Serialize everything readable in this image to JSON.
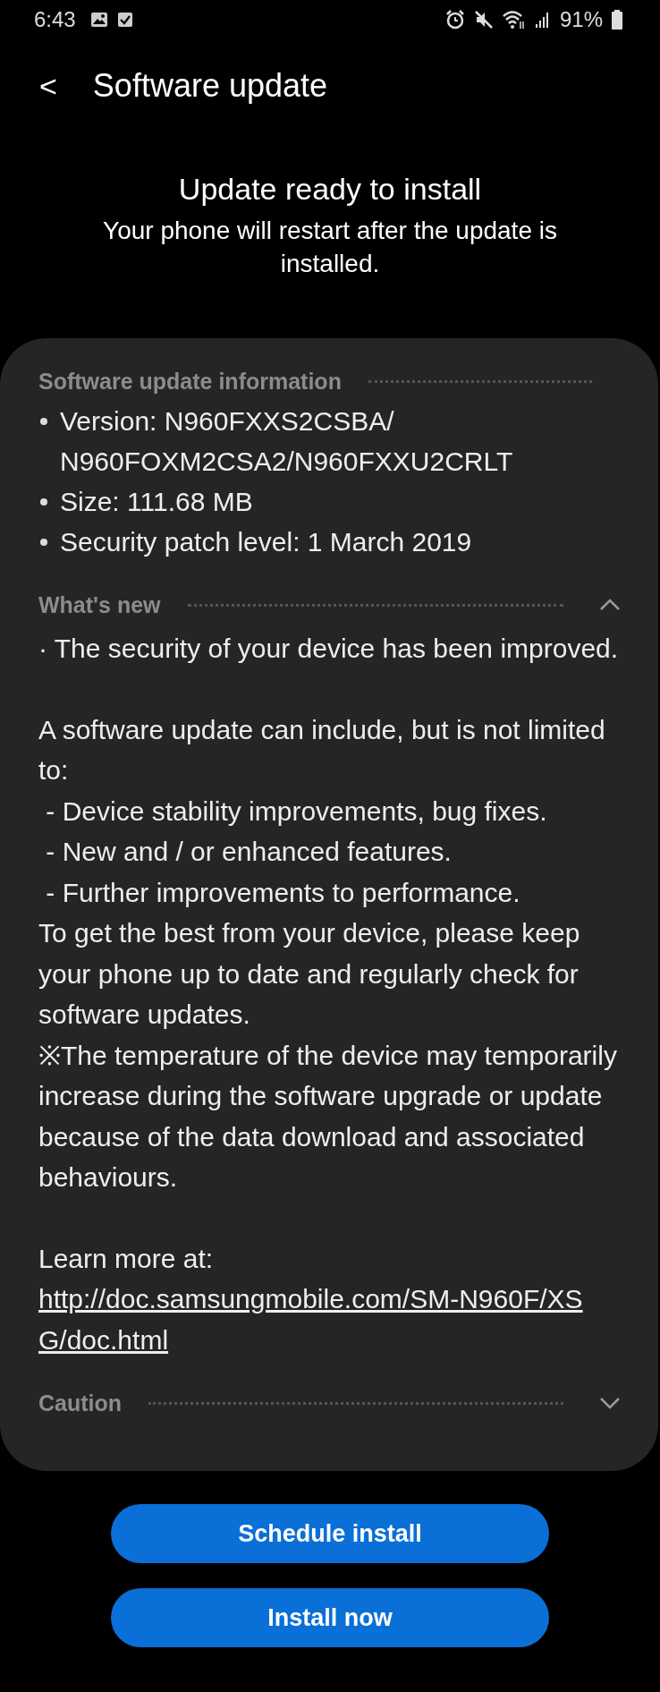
{
  "status_bar": {
    "time": "6:43",
    "battery": "91%"
  },
  "header": {
    "back": "<",
    "title": "Software update"
  },
  "status": {
    "title": "Update ready to install",
    "subtitle": "Your phone will restart after the update is installed."
  },
  "sections": [
    {
      "kind": "bullets",
      "title": "Software update information",
      "items": [
        "Version: N960FXXS2CSBA/ N960FOXM2CSA2/N960FXXU2CRLT",
        "Size: 111.68 MB",
        "Security patch level: 1 March 2019"
      ]
    },
    {
      "kind": "text",
      "title": "What's new",
      "expanded": true,
      "blocks": [
        {
          "paragraphs": [
            {
              "kind": "text",
              "text": "· The security of your device has been improved."
            }
          ]
        },
        {
          "paragraphs": [
            {
              "kind": "text",
              "text": "A software update can include, but is not limited to:"
            },
            {
              "kind": "text",
              "text": " - Device stability improvements, bug fixes."
            },
            {
              "kind": "text",
              "text": " - New and / or enhanced features."
            },
            {
              "kind": "text",
              "text": " - Further improvements to performance."
            },
            {
              "kind": "text",
              "text": "To get the best from your device, please keep your phone up to date and regularly check for software updates."
            },
            {
              "kind": "text",
              "text": "※The temperature of the device may temporarily increase during the software upgrade or update because of the data download and associated behaviours."
            }
          ]
        },
        {
          "paragraphs": [
            {
              "kind": "text",
              "text": "Learn more at:"
            },
            {
              "kind": "link",
              "text": "http://doc.samsungmobile.com/SM-N960F/XSG/doc.html"
            }
          ]
        }
      ]
    },
    {
      "title": "Caution",
      "expanded": false
    }
  ],
  "buttons": [
    "Schedule install",
    "Install now"
  ]
}
